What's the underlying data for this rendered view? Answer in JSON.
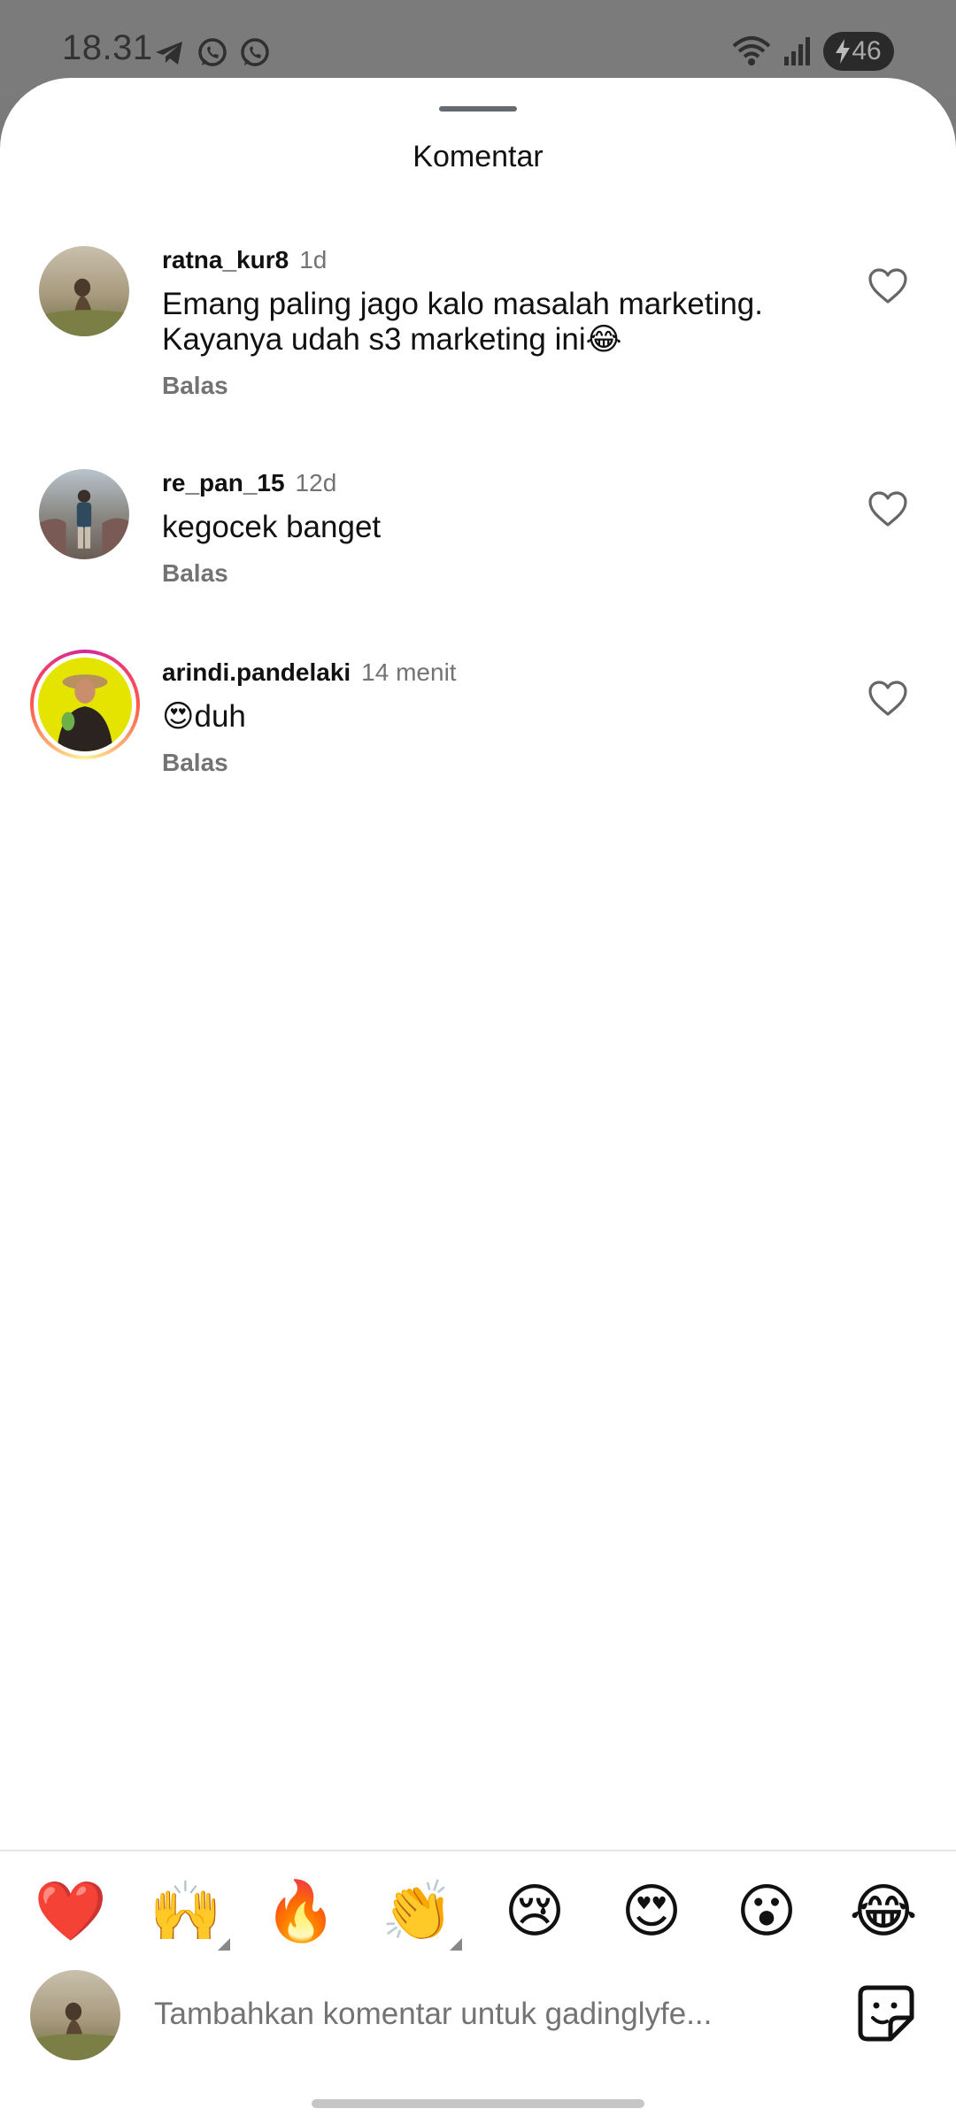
{
  "status_bar": {
    "time": "18.31",
    "battery": "46",
    "apps": [
      "telegram-icon",
      "whatsapp-icon",
      "whatsapp-icon"
    ]
  },
  "sheet": {
    "title": "Komentar"
  },
  "comments": [
    {
      "username": "ratna_kur8",
      "time": "1d",
      "text_lines": [
        "Emang paling jago kalo masalah marketing.",
        "Kayanya udah s3 marketing ini😂"
      ],
      "reply_label": "Balas",
      "liked": false,
      "has_story": false
    },
    {
      "username": "re_pan_15",
      "time": "12d",
      "text_lines": [
        "kegocek banget"
      ],
      "reply_label": "Balas",
      "liked": false,
      "has_story": false
    },
    {
      "username": "arindi.pandelaki",
      "time": "14 menit",
      "text_lines": [
        "😍duh"
      ],
      "reply_label": "Balas",
      "liked": false,
      "has_story": true
    }
  ],
  "quick_reactions": [
    "❤️",
    "🙌",
    "🔥",
    "👏",
    "😢",
    "😍",
    "😮",
    "😂"
  ],
  "composer": {
    "placeholder": "Tambahkan komentar untuk gadinglyfe..."
  },
  "colors": {
    "text_primary": "#111111",
    "text_secondary": "#737373",
    "story_ring": "#d6249f"
  }
}
